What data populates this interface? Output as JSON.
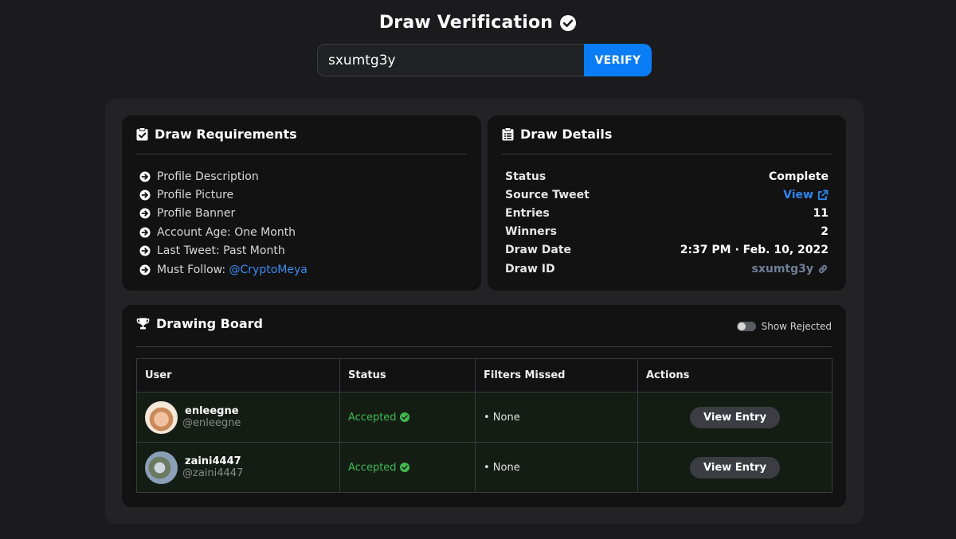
{
  "header": {
    "title": "Draw Verification",
    "check_icon": "verified-check-icon"
  },
  "search": {
    "value": "sxumtg3y",
    "button_label": "VERIFY",
    "accent": "#0a7cf5"
  },
  "requirements": {
    "title": "Draw Requirements",
    "items": [
      {
        "text": "Profile Description"
      },
      {
        "text": "Profile Picture"
      },
      {
        "text": "Profile Banner"
      },
      {
        "text": "Account Age: One Month"
      },
      {
        "text": "Last Tweet: Past Month"
      },
      {
        "text": "Must Follow: ",
        "link": "@CryptoMeya"
      }
    ]
  },
  "details": {
    "title": "Draw Details",
    "rows": [
      {
        "label": "Status",
        "value": "Complete"
      },
      {
        "label": "Source Tweet",
        "value": "View"
      },
      {
        "label": "Entries",
        "value": "11"
      },
      {
        "label": "Winners",
        "value": "2"
      },
      {
        "label": "Draw Date",
        "value": "2:37 PM · Feb. 10, 2022"
      },
      {
        "label": "Draw ID",
        "value": "sxumtg3y"
      }
    ]
  },
  "board": {
    "title": "Drawing Board",
    "toggle_label": "Show Rejected",
    "columns": [
      "User",
      "Status",
      "Filters Missed",
      "Actions"
    ],
    "rows": [
      {
        "name": "enleegne",
        "handle": "@enleegne",
        "status": "Accepted",
        "filters": "• None",
        "action": "View Entry"
      },
      {
        "name": "zaini4447",
        "handle": "@zaini4447",
        "status": "Accepted",
        "filters": "• None",
        "action": "View Entry"
      }
    ],
    "accepted_color": "#3fb950"
  }
}
